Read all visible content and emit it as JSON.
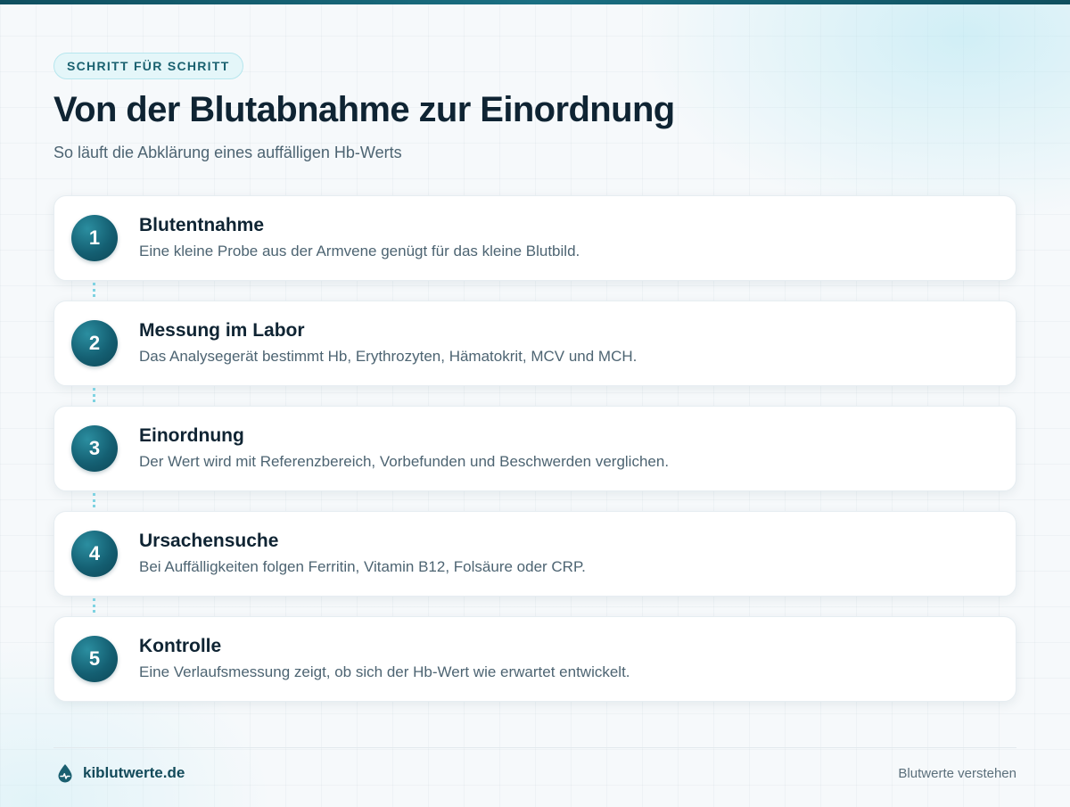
{
  "header": {
    "badge": "SCHRITT FÜR SCHRITT",
    "title": "Von der Blutabnahme zur Einordnung",
    "subtitle": "So läuft die Abklärung eines auffälligen Hb-Werts"
  },
  "steps": [
    {
      "number": "1",
      "title": "Blutentnahme",
      "description": "Eine kleine Probe aus der Armvene genügt für das kleine Blutbild."
    },
    {
      "number": "2",
      "title": "Messung im Labor",
      "description": "Das Analysegerät bestimmt Hb, Erythrozyten, Hämatokrit, MCV und MCH."
    },
    {
      "number": "3",
      "title": "Einordnung",
      "description": "Der Wert wird mit Referenzbereich, Vorbefunden und Beschwerden verglichen."
    },
    {
      "number": "4",
      "title": "Ursachensuche",
      "description": "Bei Auffälligkeiten folgen Ferritin, Vitamin B12, Folsäure oder CRP."
    },
    {
      "number": "5",
      "title": "Kontrolle",
      "description": "Eine Verlaufsmessung zeigt, ob sich der Hb-Wert wie erwartet entwickelt."
    }
  ],
  "footer": {
    "brand_icon": "blood-drop-icon",
    "brand_name": "kiblutwerte.de",
    "tagline": "Blutwerte verstehen"
  },
  "colors": {
    "accent": "#145f72",
    "badge_text": "#1a6170",
    "connector": "#7fd3e2"
  }
}
